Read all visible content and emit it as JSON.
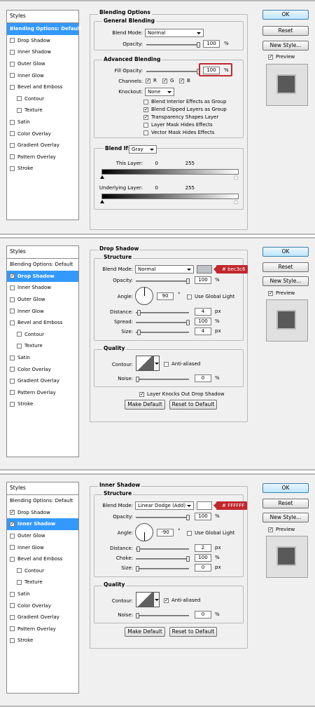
{
  "styles_header": "Styles",
  "style_items": [
    "Blending Options: Default",
    "Drop Shadow",
    "Inner Shadow",
    "Outer Glow",
    "Inner Glow",
    "Bevel and Emboss",
    "Contour",
    "Texture",
    "Satin",
    "Color Overlay",
    "Gradient Overlay",
    "Pattern Overlay",
    "Stroke"
  ],
  "buttons": {
    "ok": "OK",
    "reset": "Reset",
    "new_style": "New Style...",
    "preview": "Preview"
  },
  "panel1": {
    "section_title": "Blending Options",
    "general_title": "General Blending",
    "blend_mode_label": "Blend Mode:",
    "blend_mode_value": "Normal",
    "opacity_label": "Opacity:",
    "opacity_value": "100",
    "pct": "%",
    "advanced_title": "Advanced Blending",
    "fill_opacity_label": "Fill Opacity:",
    "fill_opacity_value": "100",
    "channels_label": "Channels:",
    "channel_r": "R",
    "channel_g": "G",
    "channel_b": "B",
    "knockout_label": "Knockout:",
    "knockout_value": "None",
    "options": [
      "Blend Interior Effects as Group",
      "Blend Clipped Layers as Group",
      "Transparency Shapes Layer",
      "Layer Mask Hides Effects",
      "Vector Mask Hides Effects"
    ],
    "blend_if_label": "Blend If:",
    "blend_if_value": "Gray",
    "this_layer_label": "This Layer:",
    "this_layer_min": "0",
    "this_layer_max": "255",
    "underlying_label": "Underlying Layer:",
    "underlying_min": "0",
    "underlying_max": "255"
  },
  "panel2": {
    "section_title": "Drop Shadow",
    "structure_title": "Structure",
    "blend_mode_label": "Blend Mode:",
    "blend_mode_value": "Normal",
    "color_tag": "# bec3c6",
    "color": "#bec3c6",
    "opacity_label": "Opacity:",
    "opacity_value": "100",
    "angle_label": "Angle:",
    "angle_value": "90",
    "degree": "°",
    "global_light": "Use Global Light",
    "distance_label": "Distance:",
    "distance_value": "4",
    "spread_label": "Spread:",
    "spread_value": "100",
    "size_label": "Size:",
    "size_value": "4",
    "px": "px",
    "pct": "%",
    "quality_title": "Quality",
    "contour_label": "Contour:",
    "anti_aliased": "Anti-aliased",
    "noise_label": "Noise:",
    "noise_value": "0",
    "knocks_out": "Layer Knocks Out Drop Shadow",
    "make_default": "Make Default",
    "reset_default": "Reset to Default"
  },
  "panel3": {
    "section_title": "Inner Shadow",
    "structure_title": "Structure",
    "blend_mode_label": "Blend Mode:",
    "blend_mode_value": "Linear Dodge (Add)",
    "color_tag": "# FFFFFF",
    "color": "#ffffff",
    "opacity_label": "Opacity:",
    "opacity_value": "100",
    "angle_label": "Angle:",
    "angle_value": "-90",
    "degree": "°",
    "global_light": "Use Global Light",
    "distance_label": "Distance:",
    "distance_value": "2",
    "choke_label": "Choke:",
    "choke_value": "100",
    "size_label": "Size:",
    "size_value": "0",
    "px": "px",
    "pct": "%",
    "quality_title": "Quality",
    "contour_label": "Contour:",
    "anti_aliased": "Anti-aliased",
    "noise_label": "Noise:",
    "noise_value": "0",
    "make_default": "Make Default",
    "reset_default": "Reset to Default"
  }
}
